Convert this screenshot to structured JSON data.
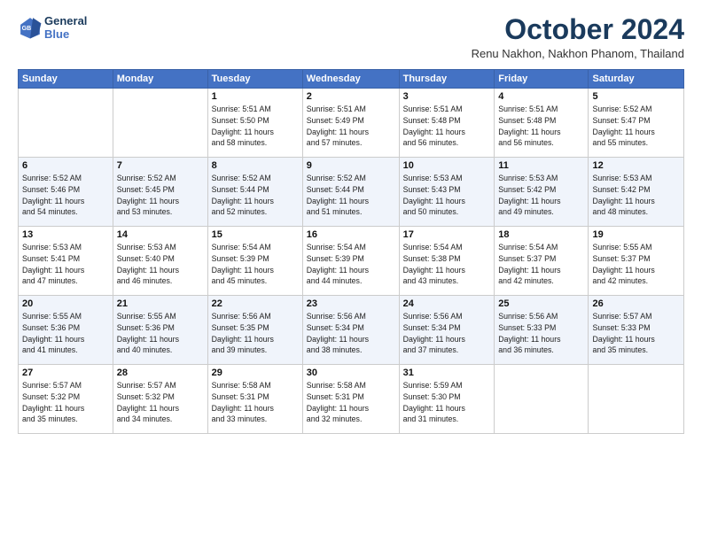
{
  "logo": {
    "line1": "General",
    "line2": "Blue"
  },
  "title": "October 2024",
  "subtitle": "Renu Nakhon, Nakhon Phanom, Thailand",
  "days_of_week": [
    "Sunday",
    "Monday",
    "Tuesday",
    "Wednesday",
    "Thursday",
    "Friday",
    "Saturday"
  ],
  "weeks": [
    [
      {
        "day": "",
        "detail": ""
      },
      {
        "day": "",
        "detail": ""
      },
      {
        "day": "1",
        "detail": "Sunrise: 5:51 AM\nSunset: 5:50 PM\nDaylight: 11 hours\nand 58 minutes."
      },
      {
        "day": "2",
        "detail": "Sunrise: 5:51 AM\nSunset: 5:49 PM\nDaylight: 11 hours\nand 57 minutes."
      },
      {
        "day": "3",
        "detail": "Sunrise: 5:51 AM\nSunset: 5:48 PM\nDaylight: 11 hours\nand 56 minutes."
      },
      {
        "day": "4",
        "detail": "Sunrise: 5:51 AM\nSunset: 5:48 PM\nDaylight: 11 hours\nand 56 minutes."
      },
      {
        "day": "5",
        "detail": "Sunrise: 5:52 AM\nSunset: 5:47 PM\nDaylight: 11 hours\nand 55 minutes."
      }
    ],
    [
      {
        "day": "6",
        "detail": "Sunrise: 5:52 AM\nSunset: 5:46 PM\nDaylight: 11 hours\nand 54 minutes."
      },
      {
        "day": "7",
        "detail": "Sunrise: 5:52 AM\nSunset: 5:45 PM\nDaylight: 11 hours\nand 53 minutes."
      },
      {
        "day": "8",
        "detail": "Sunrise: 5:52 AM\nSunset: 5:44 PM\nDaylight: 11 hours\nand 52 minutes."
      },
      {
        "day": "9",
        "detail": "Sunrise: 5:52 AM\nSunset: 5:44 PM\nDaylight: 11 hours\nand 51 minutes."
      },
      {
        "day": "10",
        "detail": "Sunrise: 5:53 AM\nSunset: 5:43 PM\nDaylight: 11 hours\nand 50 minutes."
      },
      {
        "day": "11",
        "detail": "Sunrise: 5:53 AM\nSunset: 5:42 PM\nDaylight: 11 hours\nand 49 minutes."
      },
      {
        "day": "12",
        "detail": "Sunrise: 5:53 AM\nSunset: 5:42 PM\nDaylight: 11 hours\nand 48 minutes."
      }
    ],
    [
      {
        "day": "13",
        "detail": "Sunrise: 5:53 AM\nSunset: 5:41 PM\nDaylight: 11 hours\nand 47 minutes."
      },
      {
        "day": "14",
        "detail": "Sunrise: 5:53 AM\nSunset: 5:40 PM\nDaylight: 11 hours\nand 46 minutes."
      },
      {
        "day": "15",
        "detail": "Sunrise: 5:54 AM\nSunset: 5:39 PM\nDaylight: 11 hours\nand 45 minutes."
      },
      {
        "day": "16",
        "detail": "Sunrise: 5:54 AM\nSunset: 5:39 PM\nDaylight: 11 hours\nand 44 minutes."
      },
      {
        "day": "17",
        "detail": "Sunrise: 5:54 AM\nSunset: 5:38 PM\nDaylight: 11 hours\nand 43 minutes."
      },
      {
        "day": "18",
        "detail": "Sunrise: 5:54 AM\nSunset: 5:37 PM\nDaylight: 11 hours\nand 42 minutes."
      },
      {
        "day": "19",
        "detail": "Sunrise: 5:55 AM\nSunset: 5:37 PM\nDaylight: 11 hours\nand 42 minutes."
      }
    ],
    [
      {
        "day": "20",
        "detail": "Sunrise: 5:55 AM\nSunset: 5:36 PM\nDaylight: 11 hours\nand 41 minutes."
      },
      {
        "day": "21",
        "detail": "Sunrise: 5:55 AM\nSunset: 5:36 PM\nDaylight: 11 hours\nand 40 minutes."
      },
      {
        "day": "22",
        "detail": "Sunrise: 5:56 AM\nSunset: 5:35 PM\nDaylight: 11 hours\nand 39 minutes."
      },
      {
        "day": "23",
        "detail": "Sunrise: 5:56 AM\nSunset: 5:34 PM\nDaylight: 11 hours\nand 38 minutes."
      },
      {
        "day": "24",
        "detail": "Sunrise: 5:56 AM\nSunset: 5:34 PM\nDaylight: 11 hours\nand 37 minutes."
      },
      {
        "day": "25",
        "detail": "Sunrise: 5:56 AM\nSunset: 5:33 PM\nDaylight: 11 hours\nand 36 minutes."
      },
      {
        "day": "26",
        "detail": "Sunrise: 5:57 AM\nSunset: 5:33 PM\nDaylight: 11 hours\nand 35 minutes."
      }
    ],
    [
      {
        "day": "27",
        "detail": "Sunrise: 5:57 AM\nSunset: 5:32 PM\nDaylight: 11 hours\nand 35 minutes."
      },
      {
        "day": "28",
        "detail": "Sunrise: 5:57 AM\nSunset: 5:32 PM\nDaylight: 11 hours\nand 34 minutes."
      },
      {
        "day": "29",
        "detail": "Sunrise: 5:58 AM\nSunset: 5:31 PM\nDaylight: 11 hours\nand 33 minutes."
      },
      {
        "day": "30",
        "detail": "Sunrise: 5:58 AM\nSunset: 5:31 PM\nDaylight: 11 hours\nand 32 minutes."
      },
      {
        "day": "31",
        "detail": "Sunrise: 5:59 AM\nSunset: 5:30 PM\nDaylight: 11 hours\nand 31 minutes."
      },
      {
        "day": "",
        "detail": ""
      },
      {
        "day": "",
        "detail": ""
      }
    ]
  ]
}
